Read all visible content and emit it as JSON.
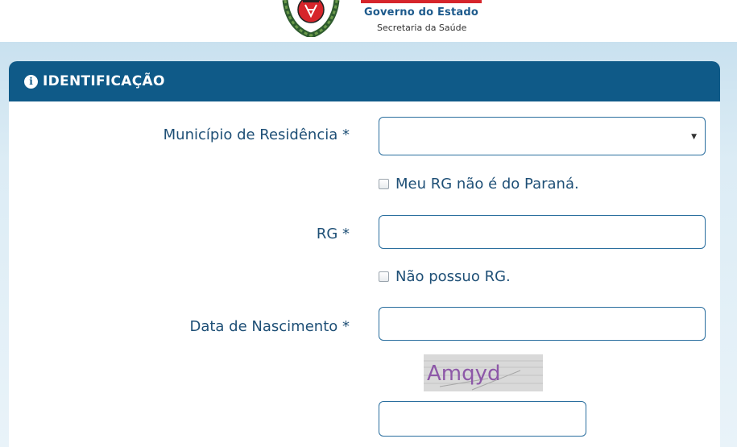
{
  "header": {
    "gov_title": "Governo do Estado",
    "gov_subtitle": "Secretaria da Saúde"
  },
  "panel": {
    "title": "IDENTIFICAÇÃO",
    "icon": "info-icon"
  },
  "form": {
    "municipio_label": "Município de Residência *",
    "municipio_value": "",
    "rg_not_parana_label": "Meu RG não é do Paraná.",
    "rg_label": "RG *",
    "rg_value": "",
    "no_rg_label": "Não possuo RG.",
    "birth_label": "Data de Nascimento *",
    "birth_value": "",
    "captcha_text": "Amqyd",
    "captcha_value": ""
  },
  "colors": {
    "panel_header": "#0f5a88",
    "label_text": "#1e4f76",
    "field_border": "#2a6e9e",
    "brand_red": "#d6252b"
  }
}
